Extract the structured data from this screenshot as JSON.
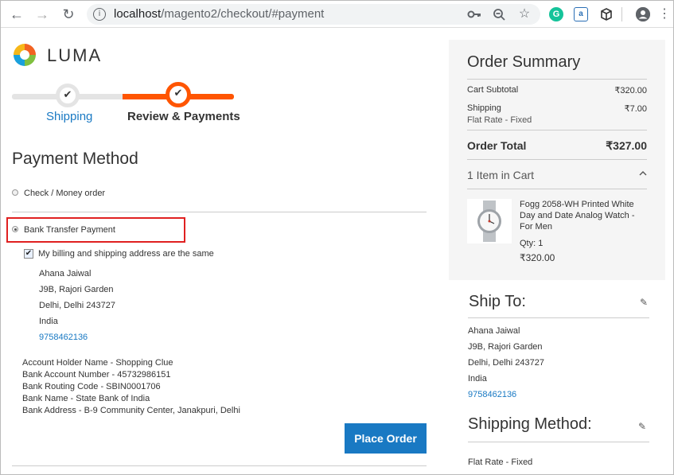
{
  "browser": {
    "url_host": "localhost",
    "url_path": "/magento2/checkout/#payment",
    "icons": [
      "back-icon",
      "forward-icon",
      "reload-icon",
      "info-icon",
      "key-icon",
      "zoom-icon",
      "star-icon",
      "grammarly-icon",
      "extension-icon",
      "cube-icon",
      "menu-icon",
      "account-icon"
    ]
  },
  "logo": {
    "text": "LUMA"
  },
  "progress": {
    "steps": [
      {
        "label": "Shipping",
        "state": "done"
      },
      {
        "label": "Review & Payments",
        "state": "current"
      }
    ]
  },
  "payment": {
    "title": "Payment Method",
    "options": [
      {
        "label": "Check / Money order",
        "selected": false
      },
      {
        "label": "Bank Transfer Payment",
        "selected": true
      }
    ],
    "same_address_label": "My billing and shipping address are the same",
    "same_address_checked": true,
    "address": {
      "name": "Ahana Jaiwal",
      "street": "J9B, Rajori Garden",
      "city": "Delhi, Delhi 243727",
      "country": "India",
      "phone": "9758462136"
    },
    "bank_details": [
      "Account Holder Name - Shopping Clue",
      "Bank Account Number - 45732986151",
      "Bank Routing Code - SBIN0001706",
      "Bank Name - State Bank of India",
      "Bank Address - B-9 Community Center, Janakpuri, Delhi"
    ],
    "place_order_label": "Place Order",
    "accent_color": "#1979c3"
  },
  "summary": {
    "title": "Order Summary",
    "subtotal_label": "Cart Subtotal",
    "subtotal_value": "₹320.00",
    "shipping_label": "Shipping",
    "shipping_value": "₹7.00",
    "shipping_method": "Flat Rate - Fixed",
    "total_label": "Order Total",
    "total_value": "₹327.00",
    "items_label": "1 Item in Cart",
    "item": {
      "name": "Fogg 2058-WH Printed White Day and Date Analog Watch - For Men",
      "qty": "Qty: 1",
      "price": "₹320.00"
    }
  },
  "ship_to": {
    "title": "Ship To:",
    "name": "Ahana Jaiwal",
    "street": "J9B, Rajori Garden",
    "city": "Delhi, Delhi 243727",
    "country": "India",
    "phone": "9758462136"
  },
  "shipping_method": {
    "title": "Shipping Method:",
    "value": "Flat Rate - Fixed"
  },
  "colors": {
    "progress_active": "#ff5501",
    "highlight_border": "#e02020"
  }
}
